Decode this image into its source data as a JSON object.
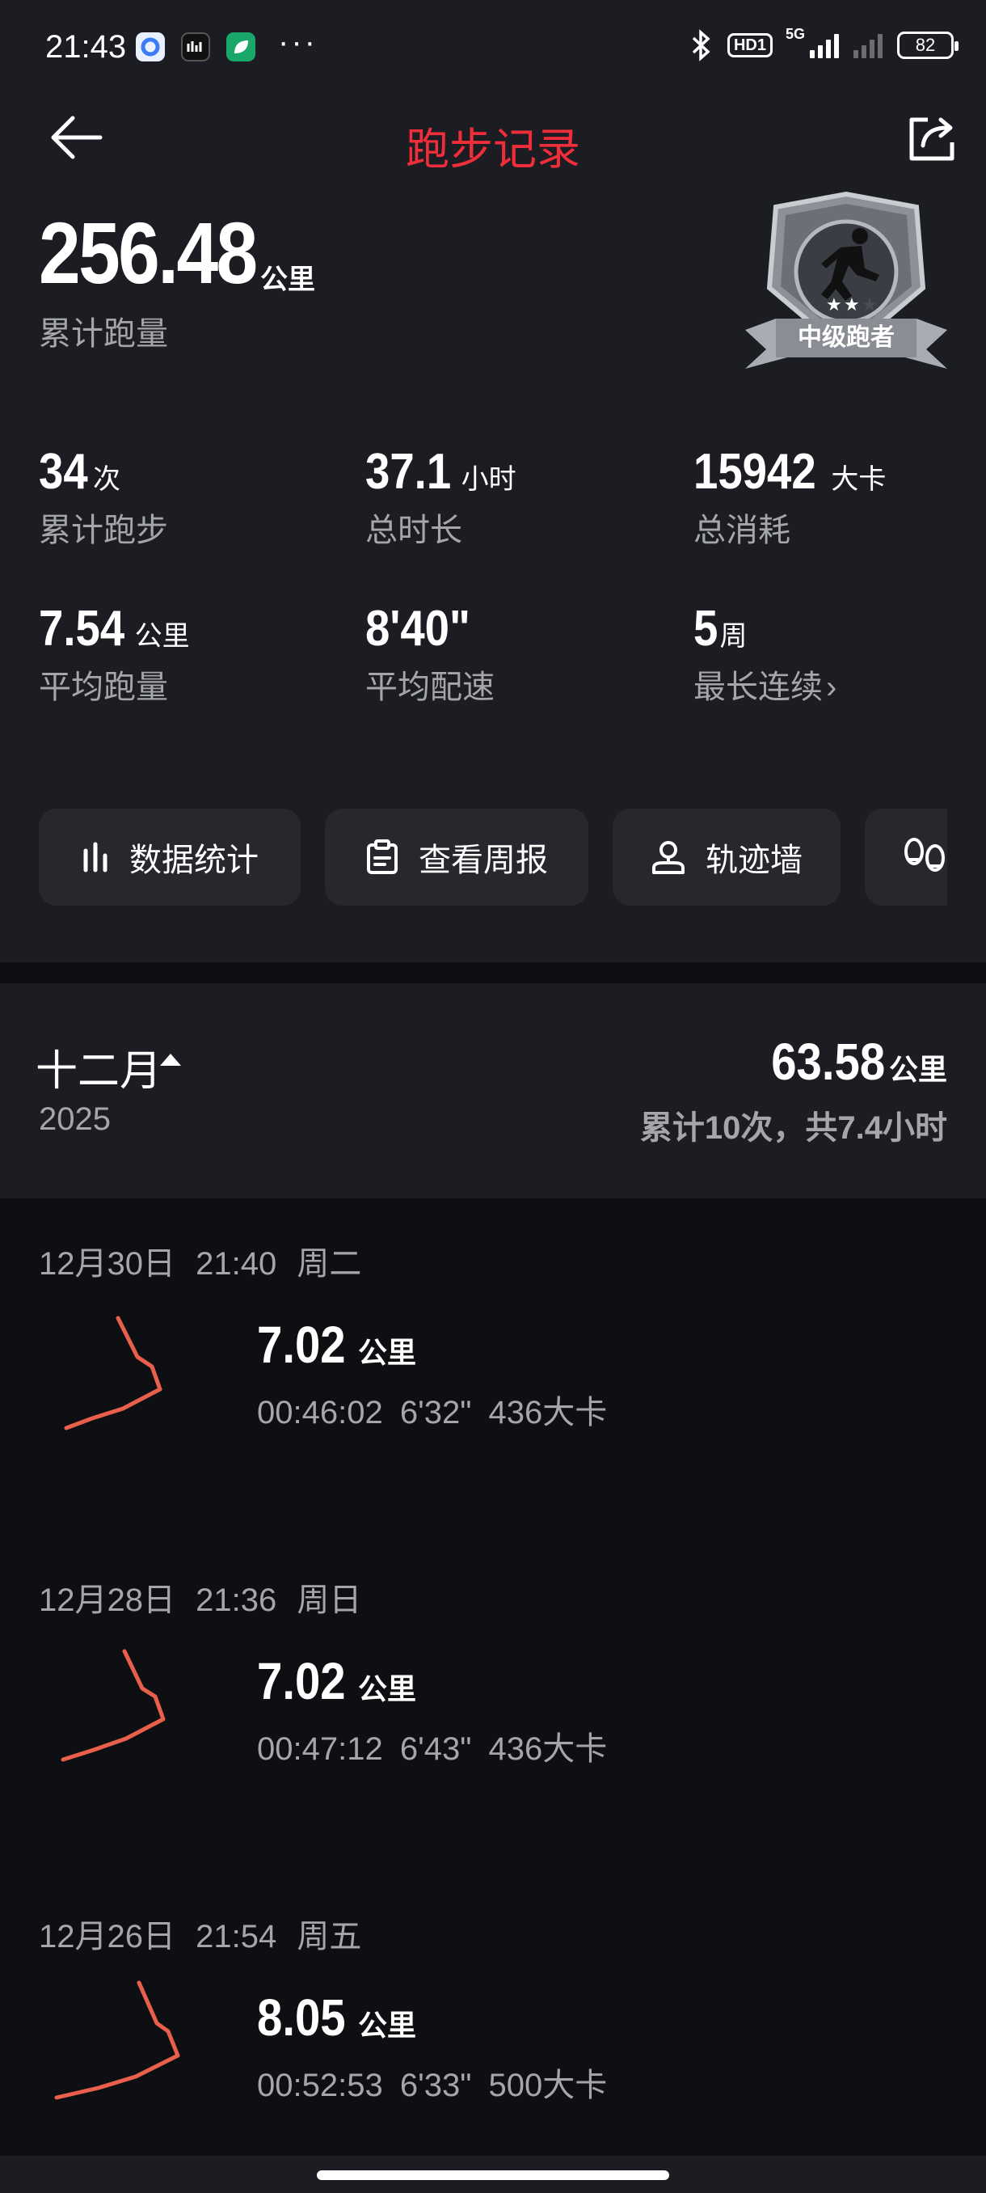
{
  "status_bar": {
    "time": "21:43",
    "hd_label": "HD1",
    "network": "5G",
    "battery": "82"
  },
  "header": {
    "title": "跑步记录",
    "title_color": "#f02d3a"
  },
  "summary": {
    "total_distance": "256.48",
    "total_unit": "公里",
    "total_label": "累计跑量",
    "badge_label": "中级跑者",
    "badge_stars_filled": 2,
    "badge_stars_total": 3
  },
  "stats": [
    {
      "value": "34",
      "unit": "次",
      "label": "累计跑步"
    },
    {
      "value": "37.1",
      "unit": "小时",
      "label": "总时长"
    },
    {
      "value": "15942",
      "unit": "大卡",
      "label": "总消耗"
    },
    {
      "value": "7.54",
      "unit": "公里",
      "label": "平均跑量"
    },
    {
      "value": "8'40\"",
      "unit": "",
      "label": "平均配速"
    },
    {
      "value": "5",
      "unit": "周",
      "label": "最长连续"
    }
  ],
  "action_buttons": [
    {
      "label": "数据统计",
      "icon": "bar-chart-icon"
    },
    {
      "label": "查看周报",
      "icon": "clipboard-icon"
    },
    {
      "label": "轨迹墙",
      "icon": "map-pin-icon"
    },
    {
      "label": "",
      "icon": "footprints-icon"
    }
  ],
  "month": {
    "name": "十二月",
    "year": "2025",
    "distance": "63.58",
    "distance_unit": "公里",
    "summary": "累计10次，共7.4小时"
  },
  "records": [
    {
      "date": "12月30日",
      "time": "21:40",
      "weekday": "周二",
      "distance": "7.02",
      "unit": "公里",
      "duration": "00:46:02",
      "pace": "6'32\"",
      "calories": "436大卡"
    },
    {
      "date": "12月28日",
      "time": "21:36",
      "weekday": "周日",
      "distance": "7.02",
      "unit": "公里",
      "duration": "00:47:12",
      "pace": "6'43\"",
      "calories": "436大卡"
    },
    {
      "date": "12月26日",
      "time": "21:54",
      "weekday": "周五",
      "distance": "8.05",
      "unit": "公里",
      "duration": "00:52:53",
      "pace": "6'33\"",
      "calories": "500大卡"
    }
  ],
  "colors": {
    "track": "#e8604c",
    "background": "#0e0f12",
    "card": "#1b1d22",
    "button": "#26282e"
  }
}
